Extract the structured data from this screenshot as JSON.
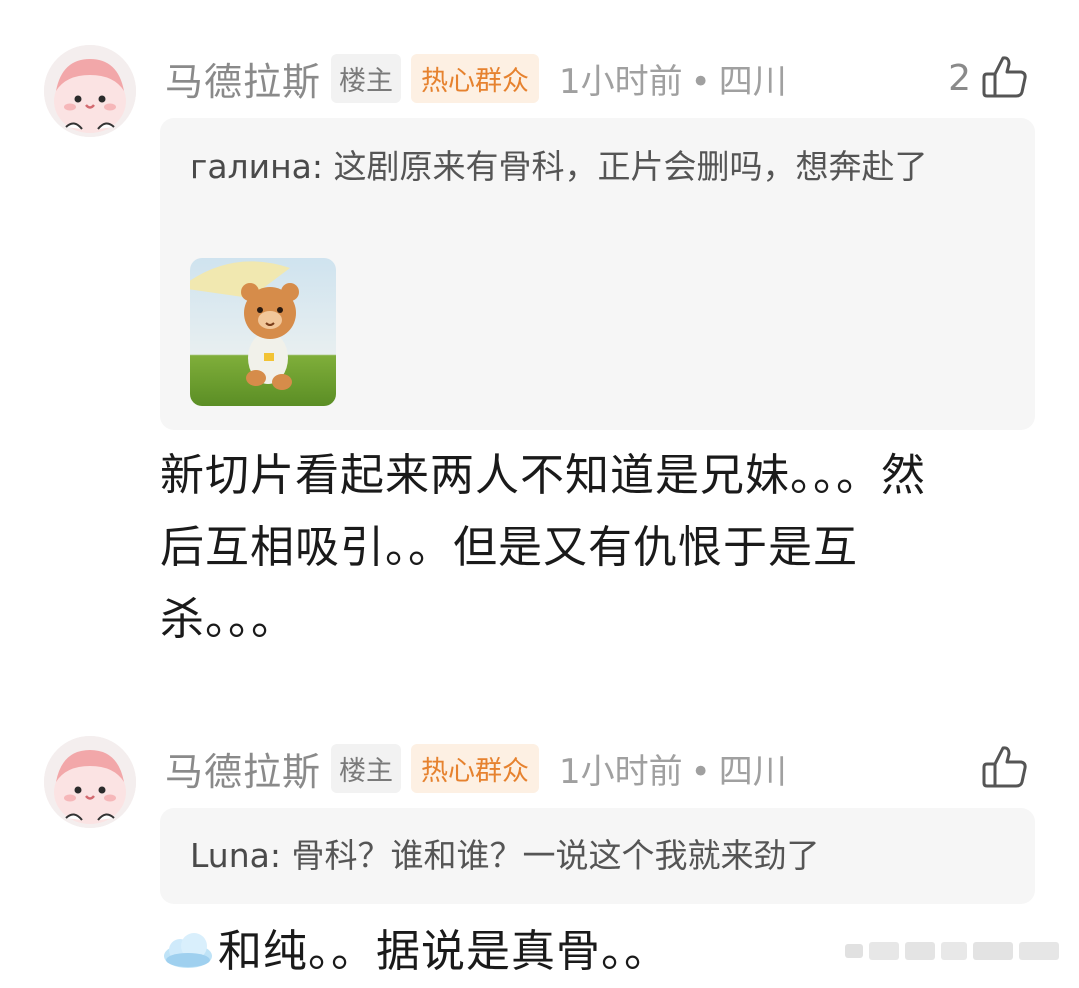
{
  "comments": [
    {
      "username": "马德拉斯",
      "badge_owner": "楼主",
      "badge_fan": "热心群众",
      "time": "1小时前",
      "separator": "•",
      "location": "四川",
      "likes": "2",
      "quote_name": "галина:",
      "quote_text": "这剧原来有骨科，正片会删吗，想奔赴了",
      "body_lines": [
        "新切片看起来两人不知道是兄妹。。。然",
        "后互相吸引。。但是又有仇恨于是互",
        "杀。。。"
      ]
    },
    {
      "username": "马德拉斯",
      "badge_owner": "楼主",
      "badge_fan": "热心群众",
      "time": "1小时前",
      "separator": "•",
      "location": "四川",
      "likes": "",
      "quote_name": "Luna:",
      "quote_text": "骨科？谁和谁？一说这个我就来劲了",
      "body_text": "和纯。。据说是真骨。。"
    }
  ],
  "icons": {
    "like": "thumbs-up-icon",
    "emoji": "cloud-icon",
    "sticker": "bear-sticker"
  },
  "colors": {
    "username": "#8a8a8a",
    "badge_fan_text": "#e6822f",
    "badge_fan_bg": "#fdf0e3",
    "quote_bg": "#f6f6f6"
  }
}
